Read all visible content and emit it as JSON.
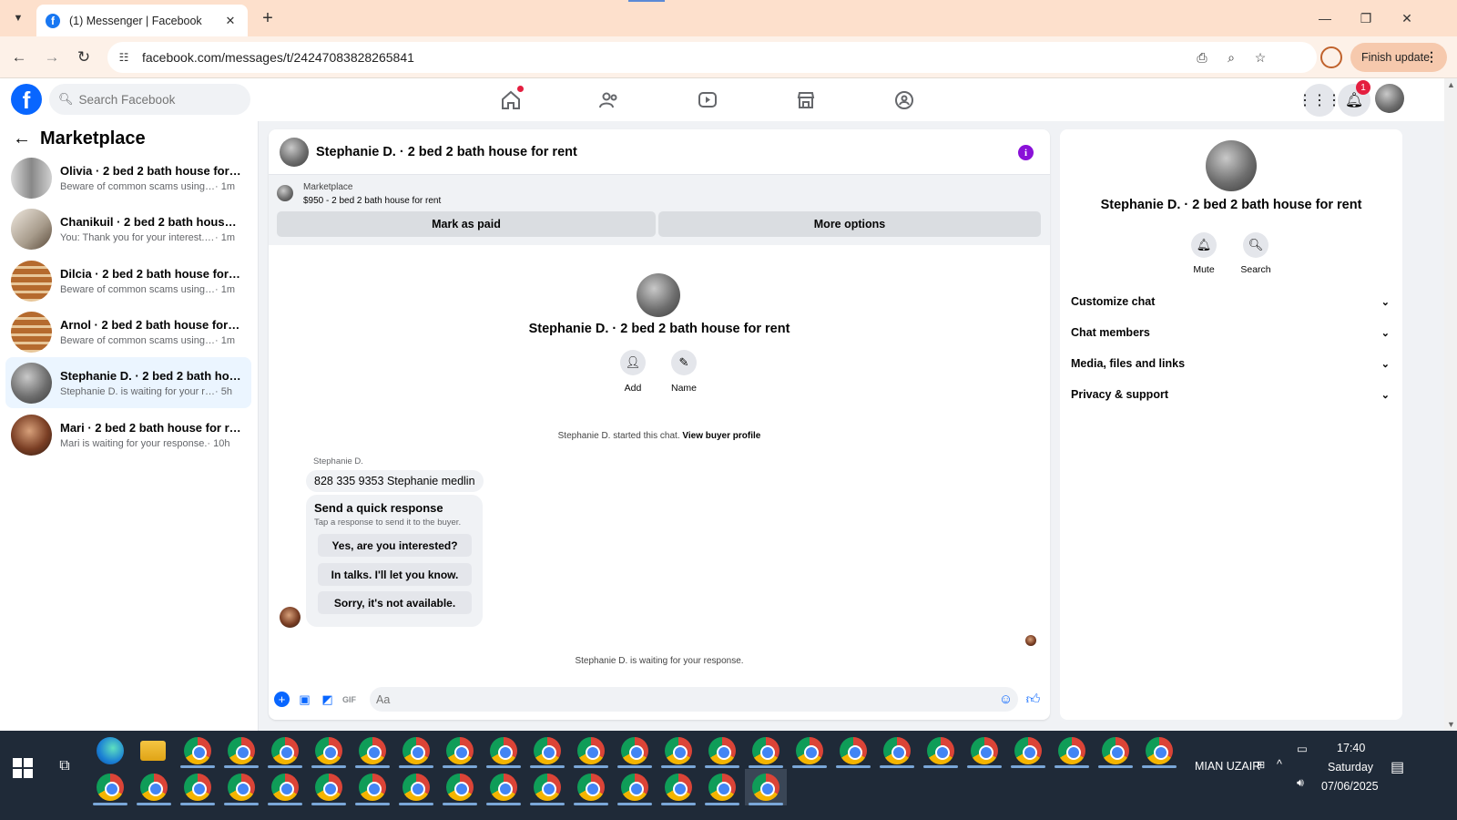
{
  "browser": {
    "tab_title": "(1) Messenger | Facebook",
    "url": "facebook.com/messages/t/24247083828265841",
    "finish_update": "Finish update",
    "new_tab_symbol": "+",
    "close_symbol": "✕"
  },
  "facebook": {
    "search_placeholder": "Search Facebook",
    "notification_count": "1",
    "nav_icons": [
      "home-icon",
      "friends-icon",
      "video-icon",
      "marketplace-icon",
      "groups-icon"
    ]
  },
  "left_panel": {
    "title": "Marketplace",
    "conversations": [
      {
        "name": "Olivia · 2 bed 2 bath house for rent",
        "preview": "Beware of common scams using pay...",
        "time": " · 1m",
        "active": false
      },
      {
        "name": "Chanikuil · 2 bed 2 bath house for ...",
        "preview": "You: Thank you for your interest. The ...",
        "time": " · 1m",
        "active": false
      },
      {
        "name": "Dilcia · 2 bed 2 bath house for rent",
        "preview": "Beware of common scams using pay...",
        "time": " · 1m",
        "active": false
      },
      {
        "name": "Arnol · 2 bed 2 bath house for rent",
        "preview": "Beware of common scams using pay...",
        "time": " · 1m",
        "active": false
      },
      {
        "name": "Stephanie D. · 2 bed 2 bath house ...",
        "preview": "Stephanie D. is waiting for your respo...",
        "time": " · 5h",
        "active": true
      },
      {
        "name": "Mari · 2 bed 2 bath house for rent",
        "preview": "Mari is waiting for your response.",
        "time": " · 10h",
        "active": false
      }
    ]
  },
  "chat": {
    "title": "Stephanie D. · 2 bed 2 bath house for rent",
    "marketplace_label": "Marketplace",
    "listing": "$950 - 2 bed 2 bath house for rent",
    "mark_paid": "Mark as paid",
    "more_options": "More options",
    "intro_name": "Stephanie D. · 2 bed 2 bath house for rent",
    "add_label": "Add",
    "name_label": "Name",
    "started_text": "Stephanie D. started this chat.",
    "view_buyer": "View buyer profile",
    "sender": "Stephanie D.",
    "message": "828 335 9353 Stephanie medlin",
    "quick_title": "Send a quick response",
    "quick_sub": "Tap a response to send it to the buyer.",
    "quick_options": [
      "Yes, are you interested?",
      "In talks. I'll let you know.",
      "Sorry, it's not available."
    ],
    "waiting": "Stephanie D. is waiting for your response.",
    "composer_placeholder": "Aa"
  },
  "right_panel": {
    "title": "Stephanie D. · 2 bed 2 bath house for rent",
    "mute": "Mute",
    "search": "Search",
    "sections": [
      "Customize chat",
      "Chat members",
      "Media, files and links",
      "Privacy & support"
    ]
  },
  "taskbar": {
    "user": "MIAN UZAIR",
    "time": "17:40",
    "day": "Saturday",
    "date": "07/06/2025"
  }
}
